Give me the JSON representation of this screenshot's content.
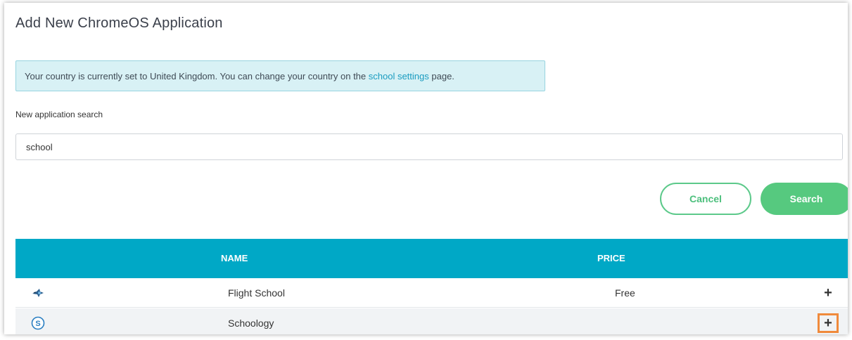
{
  "page": {
    "title": "Add New ChromeOS Application"
  },
  "info": {
    "text_before": "Your country is currently set to United Kingdom. You can change your country on the ",
    "link_text": "school settings",
    "text_after": " page."
  },
  "search": {
    "label": "New application search",
    "value": "school"
  },
  "buttons": {
    "cancel_label": "Cancel",
    "search_label": "Search"
  },
  "table": {
    "columns": [
      "NAME",
      "PRICE"
    ],
    "rows": [
      {
        "icon": "flight-school-app-icon",
        "name": "Flight School",
        "price": "Free",
        "action": "+"
      },
      {
        "icon": "schoology-app-icon",
        "name": "Schoology",
        "price": "",
        "action": "+"
      }
    ]
  },
  "colors": {
    "header_bg": "#00a8c6",
    "accent_green": "#56c97f",
    "info_bg": "#d8f1f5",
    "link": "#1a9cc0",
    "highlight_orange": "#f08a3c"
  }
}
